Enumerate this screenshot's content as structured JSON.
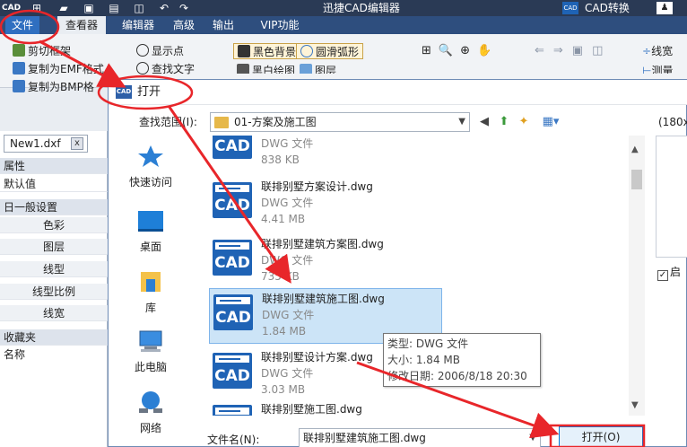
{
  "titlebar": {
    "app_logo": "CAD",
    "title": "迅捷CAD编辑器",
    "convert_label": "CAD转换",
    "convert_icon": "CAD"
  },
  "menubar": {
    "items": [
      "文件",
      "查看器",
      "编辑器",
      "高级",
      "输出",
      "VIP功能"
    ]
  },
  "ribbon": {
    "clip_frame": "剪切框架",
    "copy_emf": "复制为EMF格式",
    "copy_bmp": "复制为BMP格",
    "show_points": "显示点",
    "find_text": "查找文字",
    "black_bg": "黑色背景",
    "smooth_arc": "圆滑弧形",
    "bw_draw": "黑白绘图",
    "layers": "图层",
    "linewidth": "线宽",
    "measure": "测量"
  },
  "left_panel": {
    "doc_tab": "New1.dxf",
    "close_label": "x",
    "properties": "属性",
    "default_value": "默认值",
    "general_settings": "日一般设置",
    "settings_items": [
      "色彩",
      "图层",
      "线型",
      "线型比例",
      "线宽"
    ],
    "favorites": "收藏夹",
    "name": "名称"
  },
  "dialog": {
    "icon_text": "CAD",
    "title": "打开",
    "look_in_label": "查找范围(I):",
    "look_in_value": "01-方案及施工图",
    "preview_label": "(180x",
    "preview_check_label": "启",
    "places": [
      "快速访问",
      "桌面",
      "库",
      "此电脑",
      "网络"
    ],
    "icon_text_cad": "CAD",
    "files": [
      {
        "name": "",
        "type": "DWG 文件",
        "size": "838 KB"
      },
      {
        "name": "联排别墅方案设计.dwg",
        "type": "DWG 文件",
        "size": "4.41 MB"
      },
      {
        "name": "联排别墅建筑方案图.dwg",
        "type": "DWG 文件",
        "size": "735 KB"
      },
      {
        "name": "联排别墅建筑施工图.dwg",
        "type": "DWG 文件",
        "size": "1.84 MB"
      },
      {
        "name": "联排别墅设计方案.dwg",
        "type": "DWG 文件",
        "size": "3.03 MB"
      },
      {
        "name": "联排别墅施工图.dwg",
        "type": "",
        "size": ""
      }
    ],
    "tooltip": {
      "type_line": "类型: DWG 文件",
      "size_line": "大小: 1.84 MB",
      "date_line": "修改日期: 2006/8/18 20:30"
    },
    "filename_label": "文件名(N):",
    "filename_value": "联排别墅建筑施工图.dwg",
    "open_button": "打开(O)"
  },
  "colors": {
    "titlebar": "#2a3a55",
    "menubar": "#2e4e7e",
    "accent": "#2f6fc0",
    "annotation": "#e8262a"
  }
}
